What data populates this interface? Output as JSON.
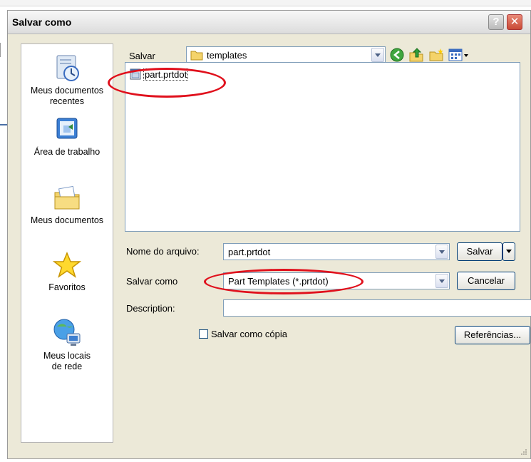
{
  "dialog": {
    "title": "Salvar como",
    "help_label": "?",
    "close_label": "✕"
  },
  "places": [
    {
      "label_line1": "Meus documentos",
      "label_line2": "recentes",
      "icon": "recent-documents-icon"
    },
    {
      "label_line1": "Área de trabalho",
      "label_line2": "",
      "icon": "desktop-icon"
    },
    {
      "label_line1": "Meus documentos",
      "label_line2": "",
      "icon": "my-documents-icon"
    },
    {
      "label_line1": "Favoritos",
      "label_line2": "",
      "icon": "favorites-icon"
    },
    {
      "label_line1": "Meus locais",
      "label_line2": "de rede",
      "icon": "network-places-icon"
    }
  ],
  "save_in": {
    "label": "Salvar",
    "value": "templates"
  },
  "files": [
    {
      "name": "part.prtdot",
      "icon": "template-file-icon"
    }
  ],
  "filename": {
    "label": "Nome do arquivo:",
    "value": "part.prtdot"
  },
  "save_as_type": {
    "label": "Salvar como",
    "value": "Part Templates (*.prtdot)"
  },
  "description": {
    "label": "Description:",
    "value": ""
  },
  "save_copy": {
    "label": "Salvar como cópia",
    "checked": false
  },
  "buttons": {
    "save": "Salvar",
    "cancel": "Cancelar",
    "references": "Referências..."
  },
  "colors": {
    "highlight_ellipse": "#e0101c",
    "dialog_bg": "#ece9d8",
    "field_border": "#7f9db9"
  }
}
